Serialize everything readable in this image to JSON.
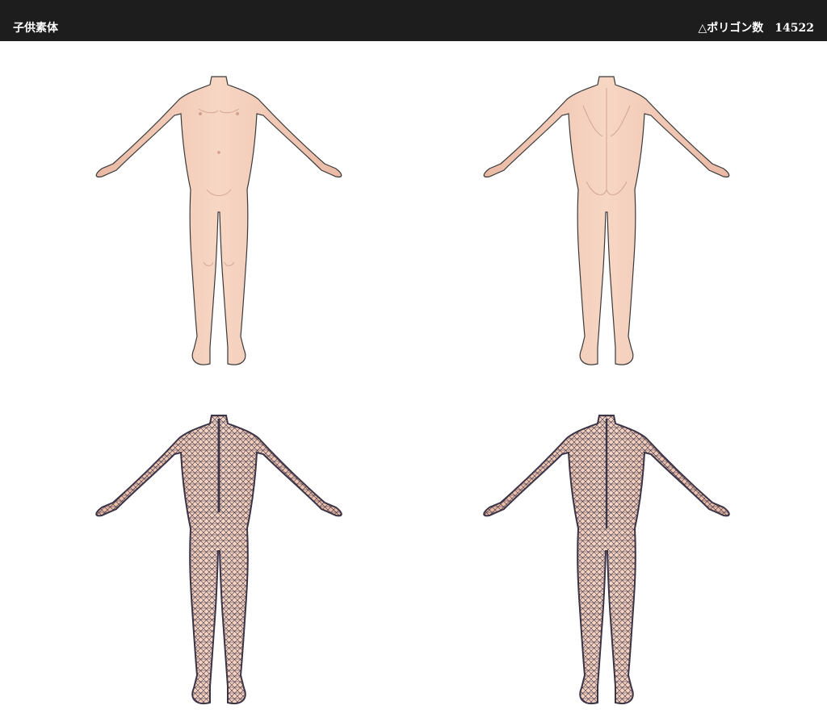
{
  "header": {
    "title": "子供素体",
    "polygon_label": "△ポリゴン数",
    "polygon_count": "14522"
  },
  "colors": {
    "header_bg": "#1d1d1d",
    "skin": "#f7d6c4",
    "skin_shadow": "#e9b9a4",
    "outline": "#3a3a3a",
    "wire": "#3b3346"
  },
  "views": [
    {
      "id": "front-shaded",
      "mode": "shaded",
      "facing": "front"
    },
    {
      "id": "back-shaded",
      "mode": "shaded",
      "facing": "back"
    },
    {
      "id": "front-wireframe",
      "mode": "wireframe",
      "facing": "front"
    },
    {
      "id": "back-wireframe",
      "mode": "wireframe",
      "facing": "back"
    }
  ]
}
